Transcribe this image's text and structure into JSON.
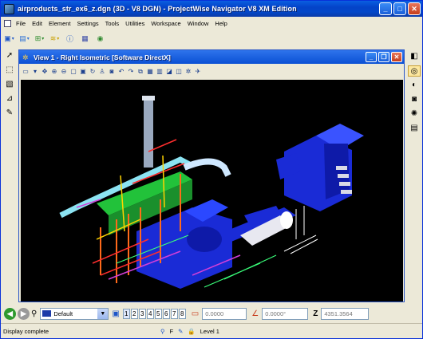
{
  "window": {
    "title": "airproducts_str_ex6_z.dgn (3D - V8 DGN) - ProjectWise Navigator V8 XM Edition"
  },
  "menu": [
    "File",
    "Edit",
    "Element",
    "Settings",
    "Tools",
    "Utilities",
    "Workspace",
    "Window",
    "Help"
  ],
  "view": {
    "title": "View 1 - Right Isometric [Software DirectX]"
  },
  "level_select": {
    "value": "Default"
  },
  "view_numbers": [
    "1",
    "2",
    "3",
    "4",
    "5",
    "6",
    "7",
    "8"
  ],
  "coords": {
    "x_value": "0.0000",
    "angle_value": "0.0000°",
    "z_label": "Z",
    "z_value": "4351.3564"
  },
  "status": {
    "message": "Display complete",
    "snap_label": "F",
    "level": "Level 1"
  },
  "colors": {
    "title_blue": "#0443c8",
    "viewport_bg": "#000000",
    "equipment_blue": "#1a2bd6",
    "pipe_green": "#22c23a"
  }
}
